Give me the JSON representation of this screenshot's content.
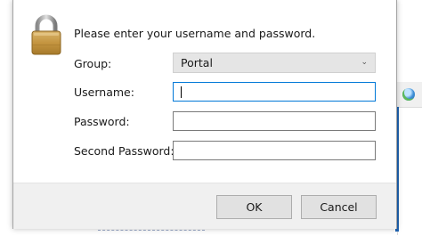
{
  "dialog": {
    "prompt": "Please enter your username and password.",
    "group_label": "Group:",
    "group_value": "Portal",
    "username_label": "Username:",
    "username_value": "",
    "password_label": "Password:",
    "password_value": "",
    "second_password_label": "Second Password:",
    "second_password_value": "",
    "ok_label": "OK",
    "cancel_label": "Cancel"
  },
  "icons": {
    "lock": "padlock-icon",
    "chevron": "chevron-down-icon",
    "globe": "globe-icon"
  },
  "colors": {
    "focus_border": "#0078d7",
    "button_bg": "#e1e1e1",
    "footer_bg": "#f0f0f0"
  }
}
